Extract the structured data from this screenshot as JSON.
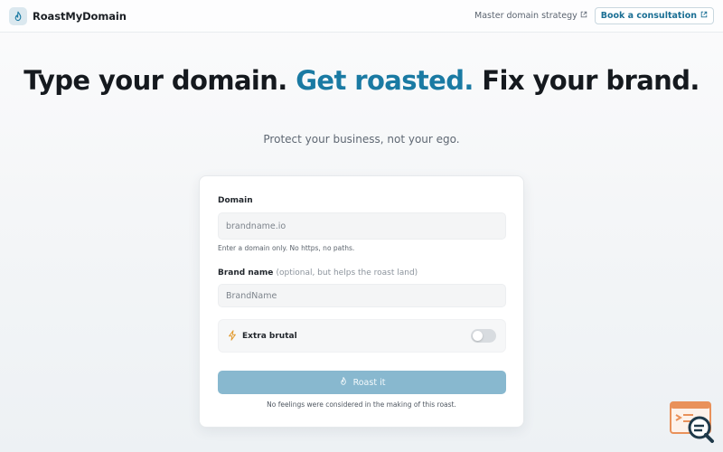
{
  "header": {
    "brand_name": "RoastMyDomain",
    "nav_link": "Master domain strategy",
    "consult_button": "Book a consultation"
  },
  "hero": {
    "title_part1": "Type your domain. ",
    "title_accent": "Get roasted.",
    "title_part2": " Fix your brand.",
    "subtitle": "Protect your business, not your ego."
  },
  "form": {
    "domain_label": "Domain",
    "domain_placeholder": "brandname.io",
    "domain_helper": "Enter a domain only. No https, no paths.",
    "brand_label": "Brand name",
    "brand_label_hint": "(optional, but helps the roast land)",
    "brand_placeholder": "BrandName",
    "extra_brutal_label": "Extra brutal",
    "extra_brutal_on": false,
    "submit_label": "Roast it",
    "footnote": "No feelings were considered in the making of this roast."
  },
  "colors": {
    "accent": "#1a7aa3",
    "button_disabled": "#88b8cf",
    "bolt": "#e29a2f"
  },
  "icons": [
    "flame-icon",
    "external-link-icon",
    "bolt-icon",
    "toggle-switch",
    "chat-support-icon"
  ]
}
